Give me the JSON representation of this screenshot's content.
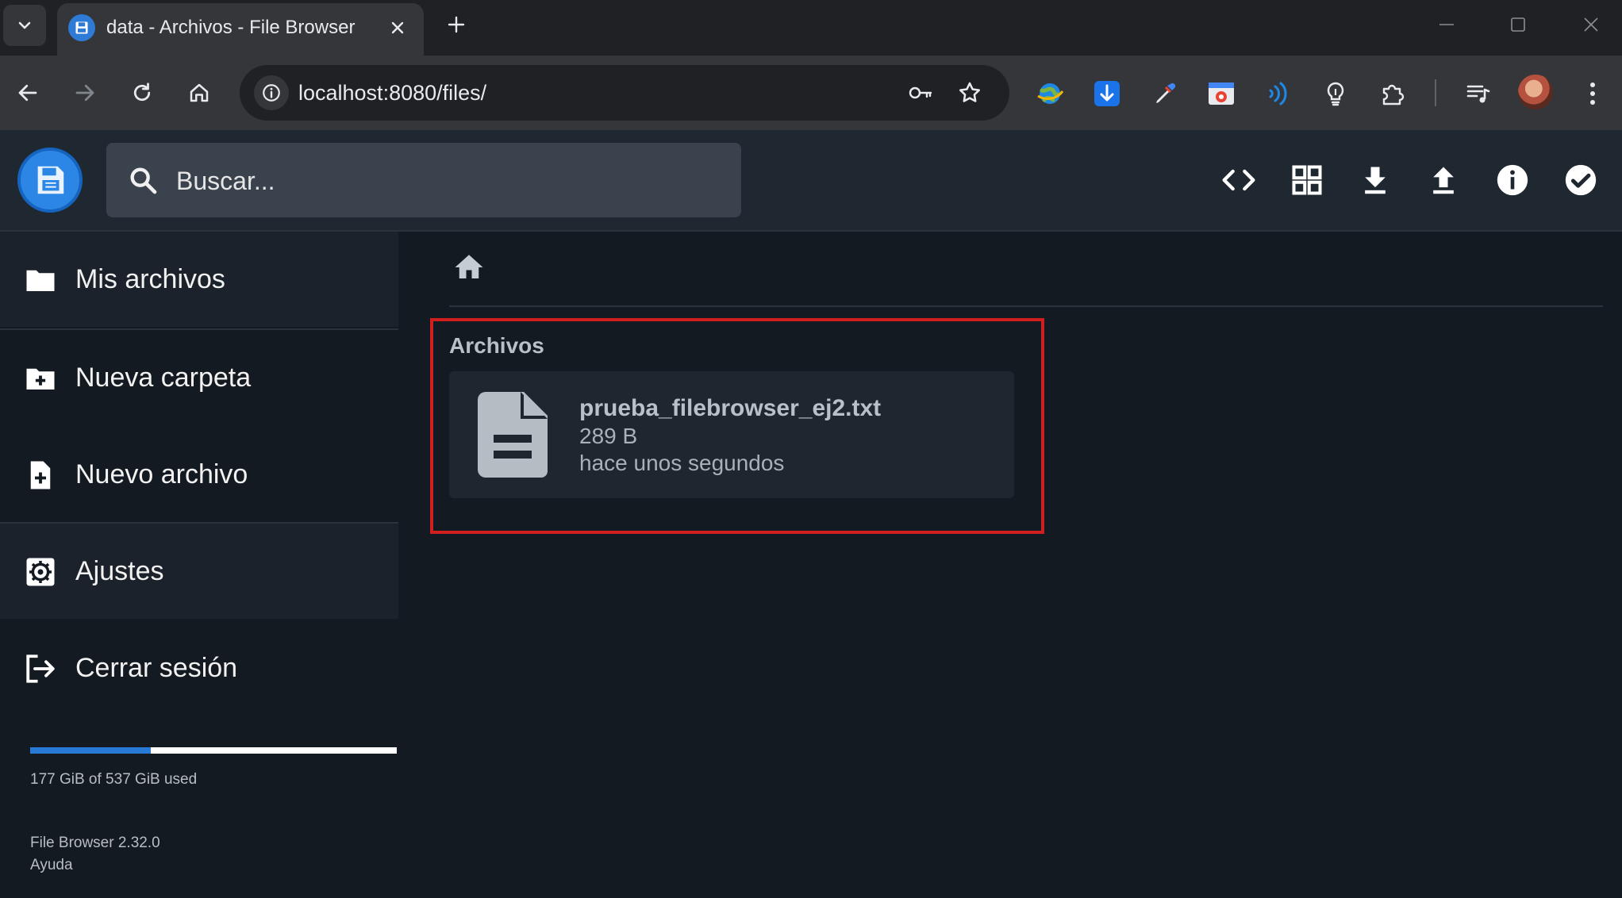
{
  "browser": {
    "tab_title": "data - Archivos - File Browser",
    "url": "localhost:8080/files/",
    "icons": {
      "tab_list": "chevron-down-icon",
      "close_tab": "close-icon",
      "new_tab": "plus-icon",
      "back": "arrow-left-icon",
      "forward": "arrow-right-icon",
      "reload": "reload-icon",
      "home": "home-icon",
      "site_info": "info-icon",
      "password": "key-icon",
      "bookmark": "star-icon",
      "media": "media-queue-icon",
      "menu": "kebab-menu-icon"
    },
    "extensions": [
      "globe-extension-icon",
      "download-extension-icon",
      "eyedropper-extension-icon",
      "screenshot-extension-icon",
      "read-aloud-extension-icon",
      "bulb-extension-icon",
      "puzzle-extension-icon"
    ]
  },
  "app": {
    "search_placeholder": "Buscar...",
    "header_actions": [
      "code-view-icon",
      "grid-view-icon",
      "download-icon",
      "upload-icon",
      "info-icon",
      "select-check-icon"
    ]
  },
  "sidebar": {
    "items": [
      {
        "label": "Mis archivos",
        "icon": "folder-icon"
      },
      {
        "label": "Nueva carpeta",
        "icon": "new-folder-icon"
      },
      {
        "label": "Nuevo archivo",
        "icon": "new-file-icon"
      },
      {
        "label": "Ajustes",
        "icon": "settings-icon"
      },
      {
        "label": "Cerrar sesión",
        "icon": "logout-icon"
      }
    ],
    "usage": {
      "text": "177 GiB of 537 GiB used",
      "fraction": 0.3296
    },
    "version": "File Browser 2.32.0",
    "help": "Ayuda"
  },
  "main": {
    "breadcrumb_icon": "home-icon",
    "section_title": "Archivos",
    "files": [
      {
        "name": "prueba_filebrowser_ej2.txt",
        "size": "289 B",
        "modified": "hace unos segundos",
        "icon": "text-file-icon"
      }
    ]
  },
  "colors": {
    "accent": "#2979d6",
    "highlight_border": "#d11e1e",
    "background": "#141a21",
    "header": "#1f2731"
  }
}
